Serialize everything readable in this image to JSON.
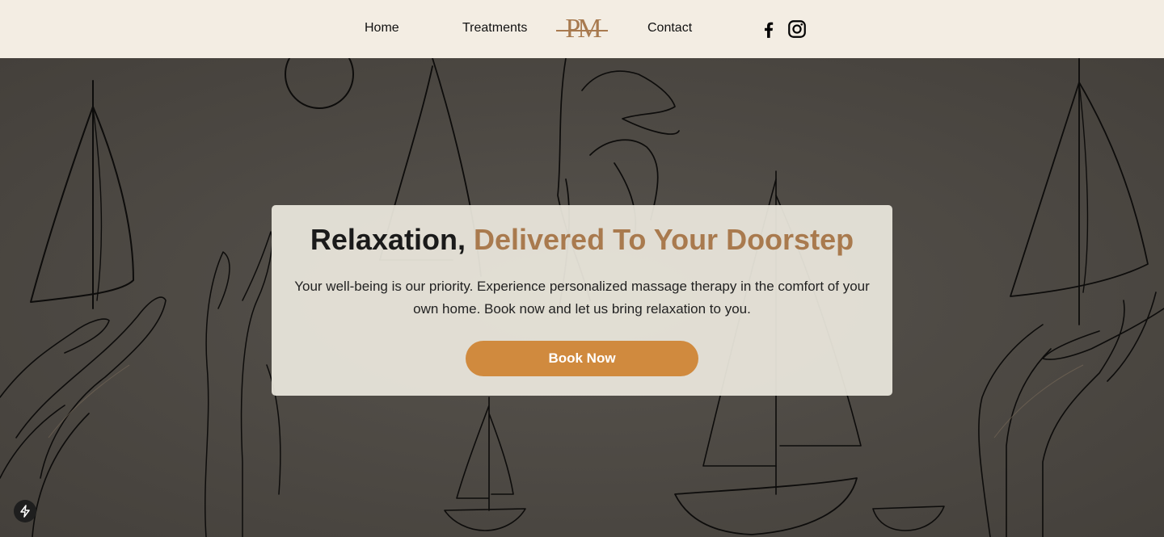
{
  "nav": {
    "home_label": "Home",
    "treatments_label": "Treatments",
    "contact_label": "Contact",
    "logo_text": "PM"
  },
  "social": {
    "facebook_icon": "facebook-icon",
    "instagram_icon": "instagram-icon"
  },
  "hero": {
    "headline_main": "Relaxation,",
    "headline_accent": "Delivered To Your Doorstep",
    "description": "Your well-being is our priority. Experience personalized massage therapy in the comfort of your own home. Book now and let us bring relaxation to you.",
    "cta_label": "Book Now"
  },
  "colors": {
    "nav_background": "#f3ede3",
    "accent_brown": "#a97a4e",
    "button_orange": "#d08a3e",
    "hero_background": "#4e4a45"
  }
}
